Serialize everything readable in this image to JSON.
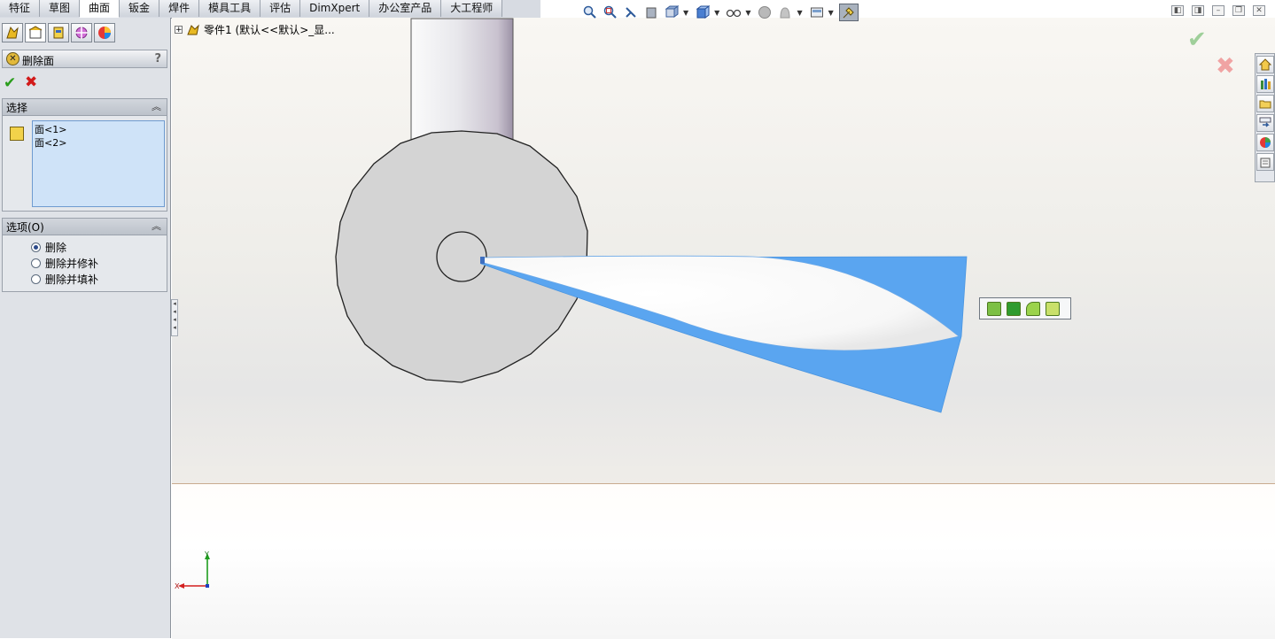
{
  "tabs": [
    "特征",
    "草图",
    "曲面",
    "钣金",
    "焊件",
    "模具工具",
    "评估",
    "DimXpert",
    "办公室产品",
    "大工程师"
  ],
  "active_tab_index": 2,
  "property_manager": {
    "title": "删除面",
    "help": "?",
    "selection_group": {
      "title": "选择",
      "items": [
        "面<1>",
        "面<2>"
      ]
    },
    "options_group": {
      "title": "选项(O)",
      "options": [
        {
          "label": "删除",
          "selected": true
        },
        {
          "label": "删除并修补",
          "selected": false
        },
        {
          "label": "删除并填补",
          "selected": false
        }
      ]
    }
  },
  "feature_tree": {
    "expand": "+",
    "label": "零件1  (默认<<默认>_显..."
  },
  "triad": {
    "x_label": "X",
    "y_label": "Y"
  },
  "colors": {
    "face_blue": "#5aa5f0",
    "part_grey": "#d4d4d4",
    "ok_green": "#2a9d1c",
    "cancel_red": "#d21a1a"
  }
}
